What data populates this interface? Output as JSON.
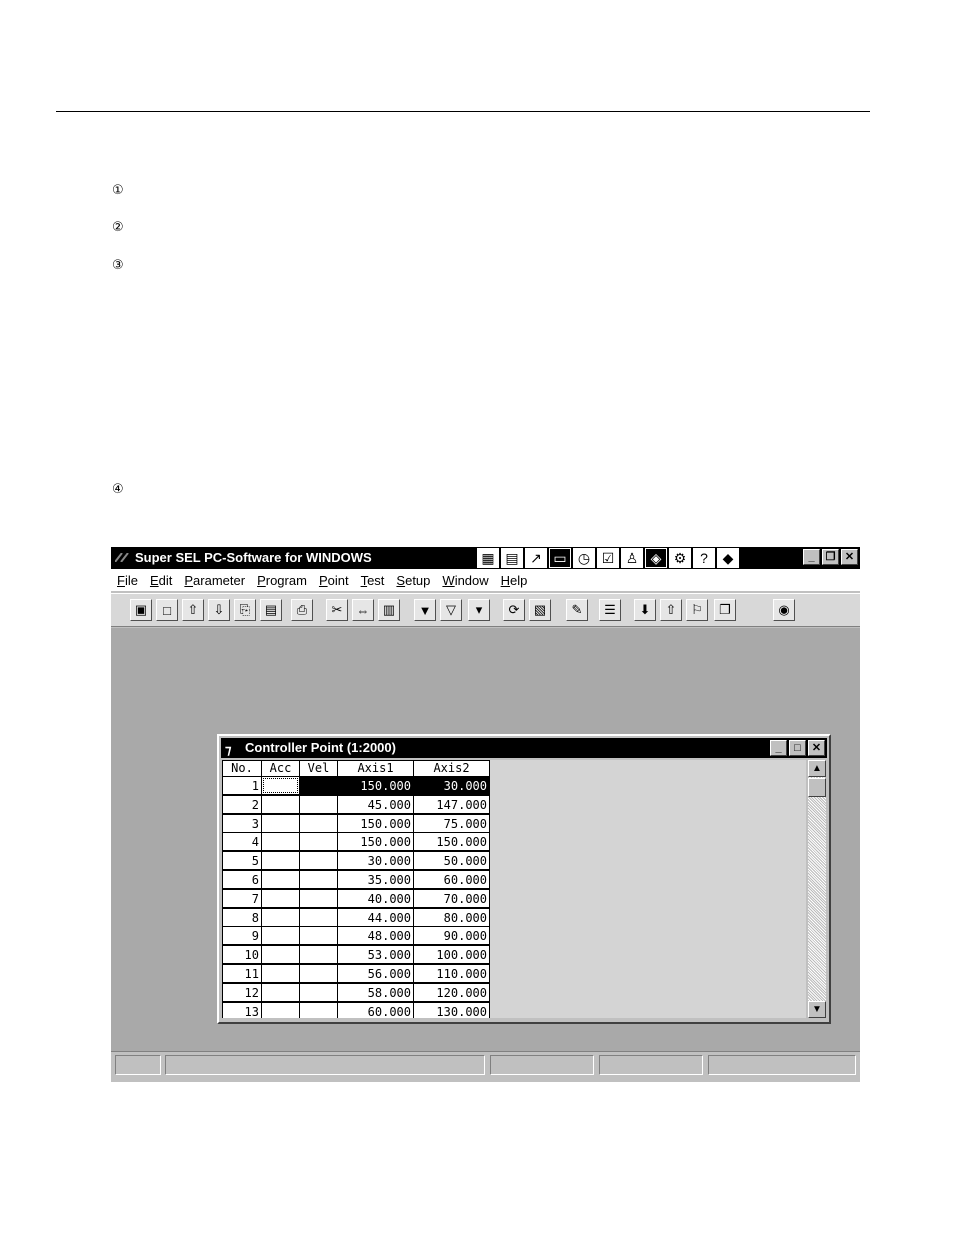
{
  "steps": [
    "①",
    "②",
    "③",
    "④"
  ],
  "app": {
    "title": "Super SEL PC-Software for WINDOWS",
    "menu": [
      "File",
      "Edit",
      "Parameter",
      "Program",
      "Point",
      "Test",
      "Setup",
      "Window",
      "Help"
    ]
  },
  "point_window": {
    "title": "Controller Point (1:2000)",
    "columns": [
      "No.",
      "Acc",
      "Vel",
      "Axis1",
      "Axis2"
    ],
    "rows": [
      {
        "no": "1",
        "acc": "",
        "vel": "",
        "axis1": "150.000",
        "axis2": "30.000"
      },
      {
        "no": "2",
        "acc": "",
        "vel": "",
        "axis1": "45.000",
        "axis2": "147.000"
      },
      {
        "no": "3",
        "acc": "",
        "vel": "",
        "axis1": "150.000",
        "axis2": "75.000"
      },
      {
        "no": "4",
        "acc": "",
        "vel": "",
        "axis1": "150.000",
        "axis2": "150.000"
      },
      {
        "no": "5",
        "acc": "",
        "vel": "",
        "axis1": "30.000",
        "axis2": "50.000"
      },
      {
        "no": "6",
        "acc": "",
        "vel": "",
        "axis1": "35.000",
        "axis2": "60.000"
      },
      {
        "no": "7",
        "acc": "",
        "vel": "",
        "axis1": "40.000",
        "axis2": "70.000"
      },
      {
        "no": "8",
        "acc": "",
        "vel": "",
        "axis1": "44.000",
        "axis2": "80.000"
      },
      {
        "no": "9",
        "acc": "",
        "vel": "",
        "axis1": "48.000",
        "axis2": "90.000"
      },
      {
        "no": "10",
        "acc": "",
        "vel": "",
        "axis1": "53.000",
        "axis2": "100.000"
      },
      {
        "no": "11",
        "acc": "",
        "vel": "",
        "axis1": "56.000",
        "axis2": "110.000"
      },
      {
        "no": "12",
        "acc": "",
        "vel": "",
        "axis1": "58.000",
        "axis2": "120.000"
      },
      {
        "no": "13",
        "acc": "",
        "vel": "",
        "axis1": "60.000",
        "axis2": "130.000"
      }
    ]
  },
  "icons": {
    "title_icons": [
      "tile-window-icon",
      "document-icon",
      "open-icon",
      "monitor-icon",
      "clock-icon",
      "check-icon",
      "person-icon",
      "book-icon",
      "gear-icon",
      "help-icon",
      "manual-icon"
    ],
    "toolbar": [
      "new-file-icon",
      "new-window-icon",
      "upload-icon",
      "download-icon",
      "copy-file-icon",
      "paste-file-icon",
      "print-icon",
      "cut-icon",
      "move-icon",
      "paste-icon",
      "select-icon",
      "select-range-icon",
      "select-ab-icon",
      "transfer-icon",
      "compare-icon",
      "edit-icon",
      "checklist-icon",
      "arrow-down-icon",
      "arrow-up-icon",
      "flag-icon",
      "window-icon",
      "stop-icon"
    ]
  }
}
